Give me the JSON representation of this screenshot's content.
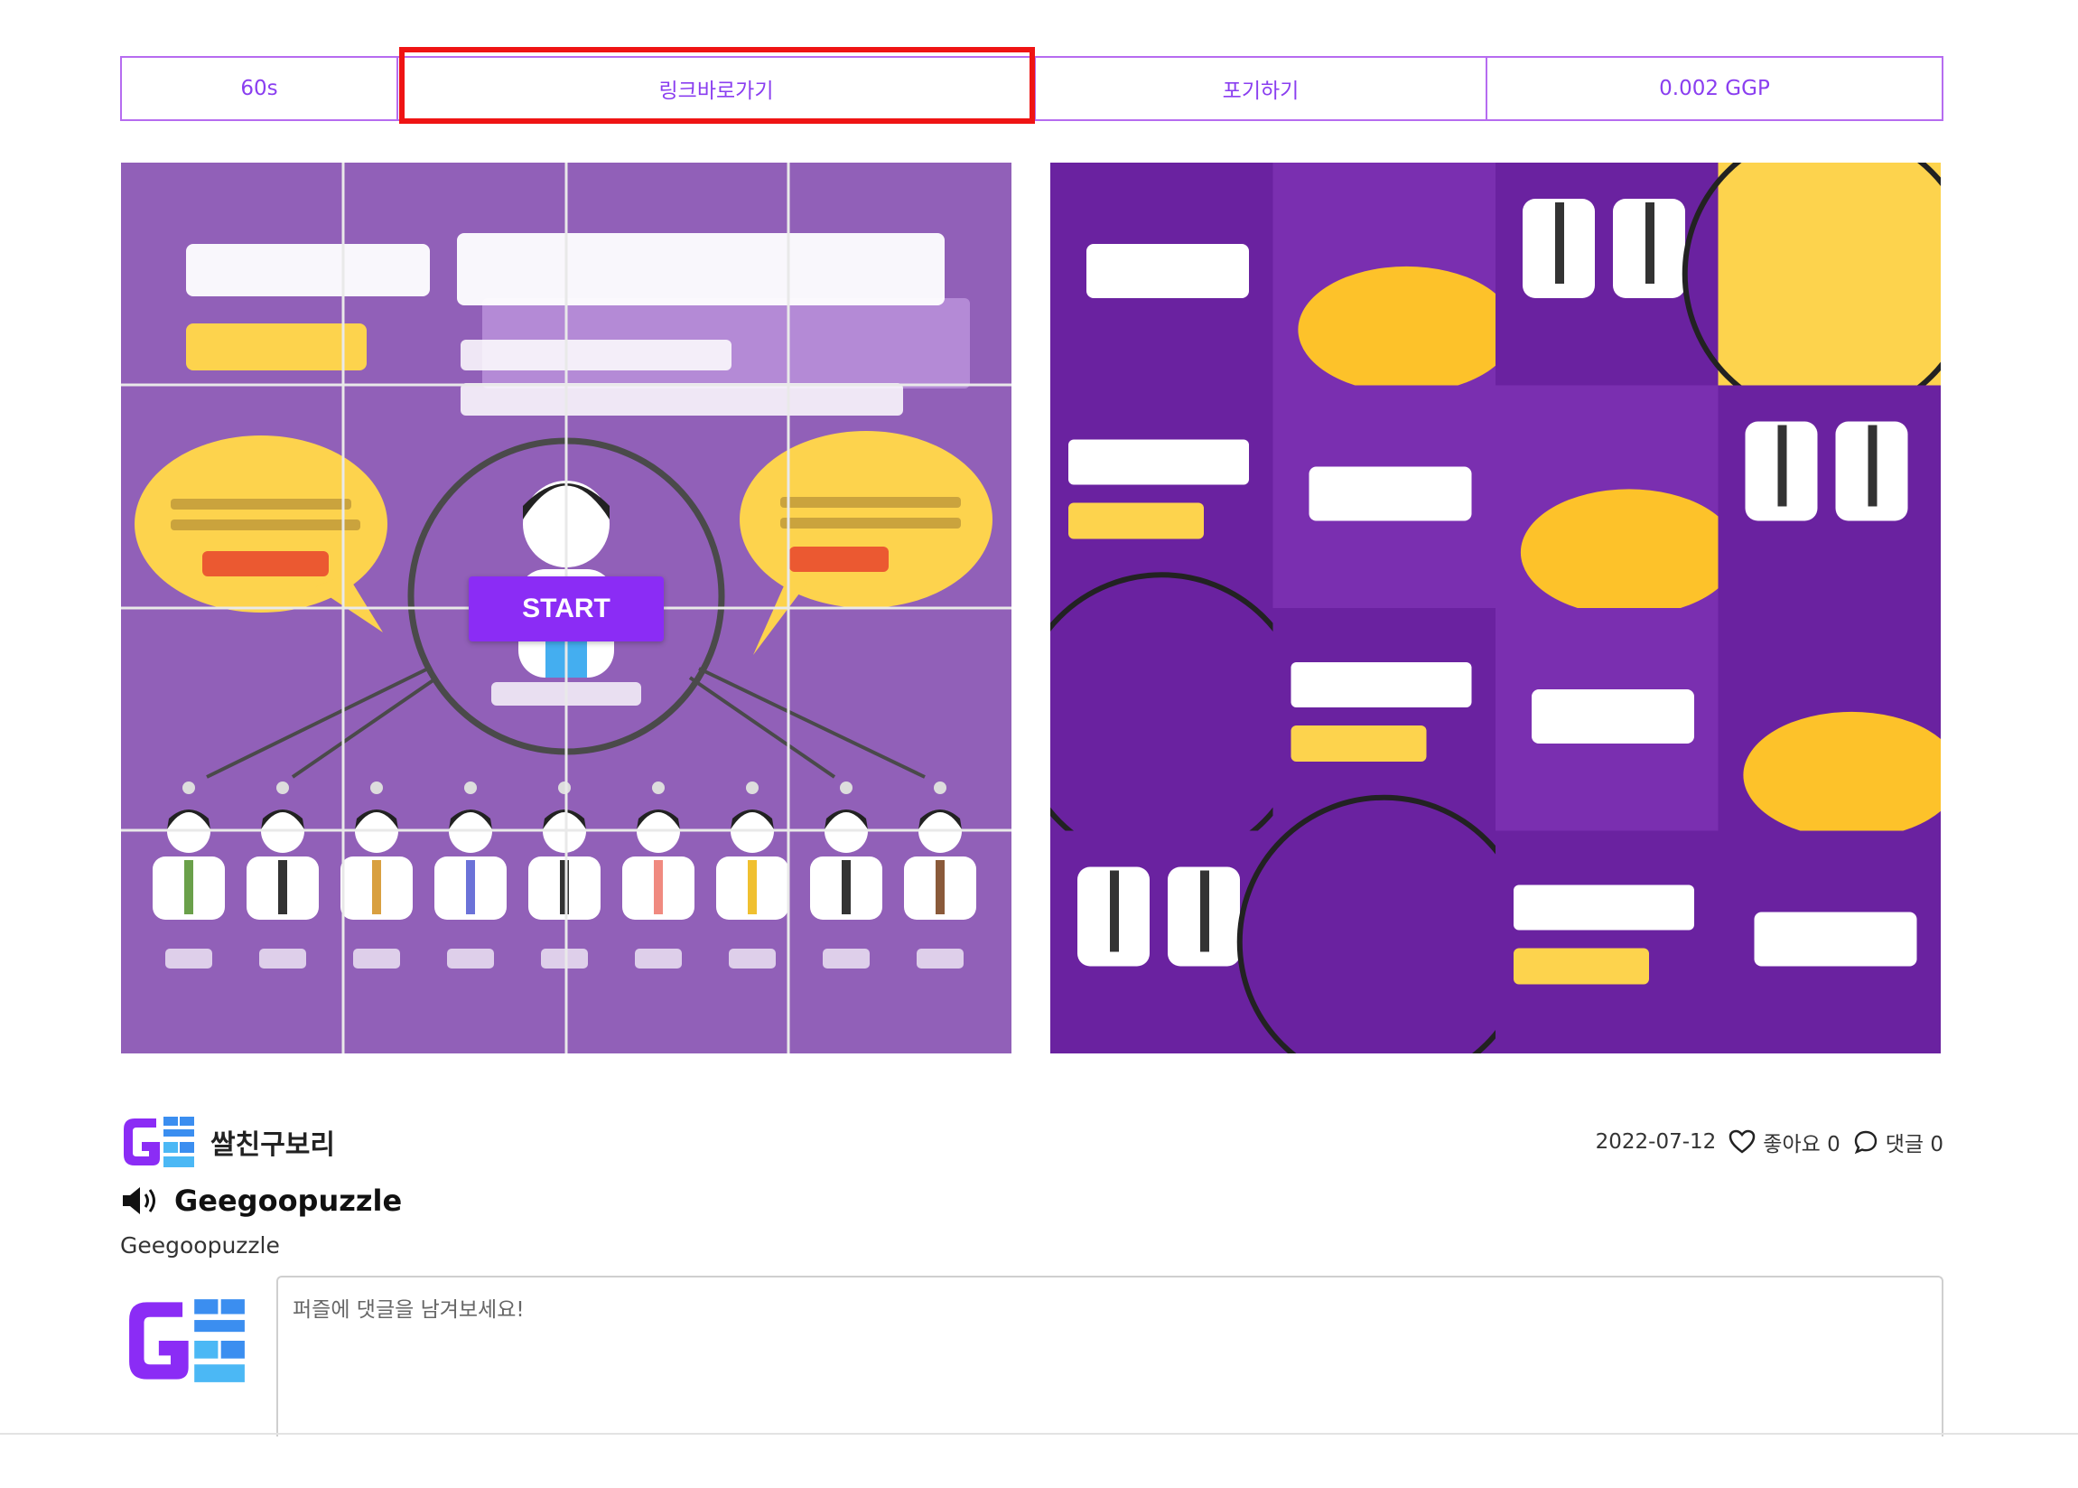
{
  "toolbar": {
    "timer": "60s",
    "link_button": "링크바로가기",
    "give_up_button": "포기하기",
    "reward": "0.002 GGP"
  },
  "puzzle": {
    "start_label": "START",
    "colors": {
      "left_bg": "#9160b8",
      "right_bg": "#6a22a0",
      "yellow": "#fdd34d",
      "accent": "#8b2cf5"
    }
  },
  "post": {
    "author": "쌀친구보리",
    "date": "2022-07-12",
    "likes_label": "좋아요 0",
    "comments_label": "댓글 0",
    "title": "Geegoopuzzle",
    "description": "Geegoopuzzle"
  },
  "comment": {
    "placeholder": "퍼즐에 댓글을 남겨보세요!"
  },
  "icons": {
    "heart": "heart-icon",
    "comment": "speech-bubble-icon",
    "speaker": "speaker-icon"
  }
}
